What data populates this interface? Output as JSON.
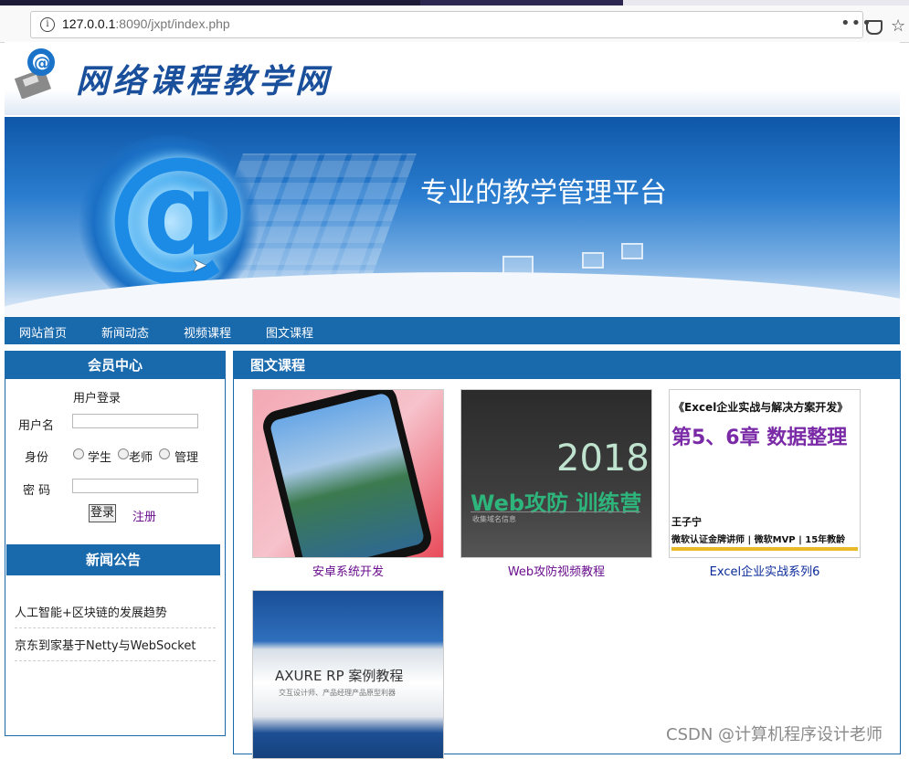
{
  "browser": {
    "url_host": "127.0.0.1",
    "url_rest": ":8090/jxpt/index.php",
    "menu_glyph": "•••",
    "star_glyph": "☆",
    "info_glyph": "i"
  },
  "site": {
    "title": "网络课程教学网",
    "slogan": "专业的教学管理平台"
  },
  "nav": [
    "网站首页",
    "新闻动态",
    "视频课程",
    "图文课程"
  ],
  "member": {
    "header": "会员中心",
    "login_title": "用户登录",
    "username_label": "用户名",
    "role_label": "身份",
    "roles": [
      "学生",
      "老师",
      "管理"
    ],
    "password_label": "密 码",
    "login_button": "登录",
    "register_link": "注册"
  },
  "news": {
    "header": "新闻公告",
    "items": [
      "人工智能+区块链的发展趋势",
      "京东到家基于Netty与WebSocket"
    ]
  },
  "courses": {
    "header": "图文课程",
    "items": [
      {
        "caption": "安卓系统开发",
        "color": "#6a0f8e"
      },
      {
        "caption": "Web攻防视频教程",
        "color": "#6a0f8e"
      },
      {
        "caption": "Excel企业实战系列6",
        "color": "#0a2a9a"
      },
      {
        "caption": "",
        "color": "#0a2a9a"
      }
    ],
    "thumb2": {
      "year": "2018",
      "title": "Web攻防 训练营",
      "sub": "收集域名信息"
    },
    "thumb3": {
      "a": "《Excel企业实战与解决方案开发》",
      "b": "第5、6章  数据整理",
      "c": "王子宁",
      "d": "微软认证金牌讲师 | 微软MVP | 15年教龄"
    },
    "thumb4": {
      "title": "AXURE RP 案例教程",
      "sub": "交互设计师、产品经理产品原型利器"
    }
  },
  "watermark": "CSDN @计算机程序设计老师",
  "colors": {
    "brand_blue": "#1969ad",
    "link_purple": "#6a0f8e"
  }
}
